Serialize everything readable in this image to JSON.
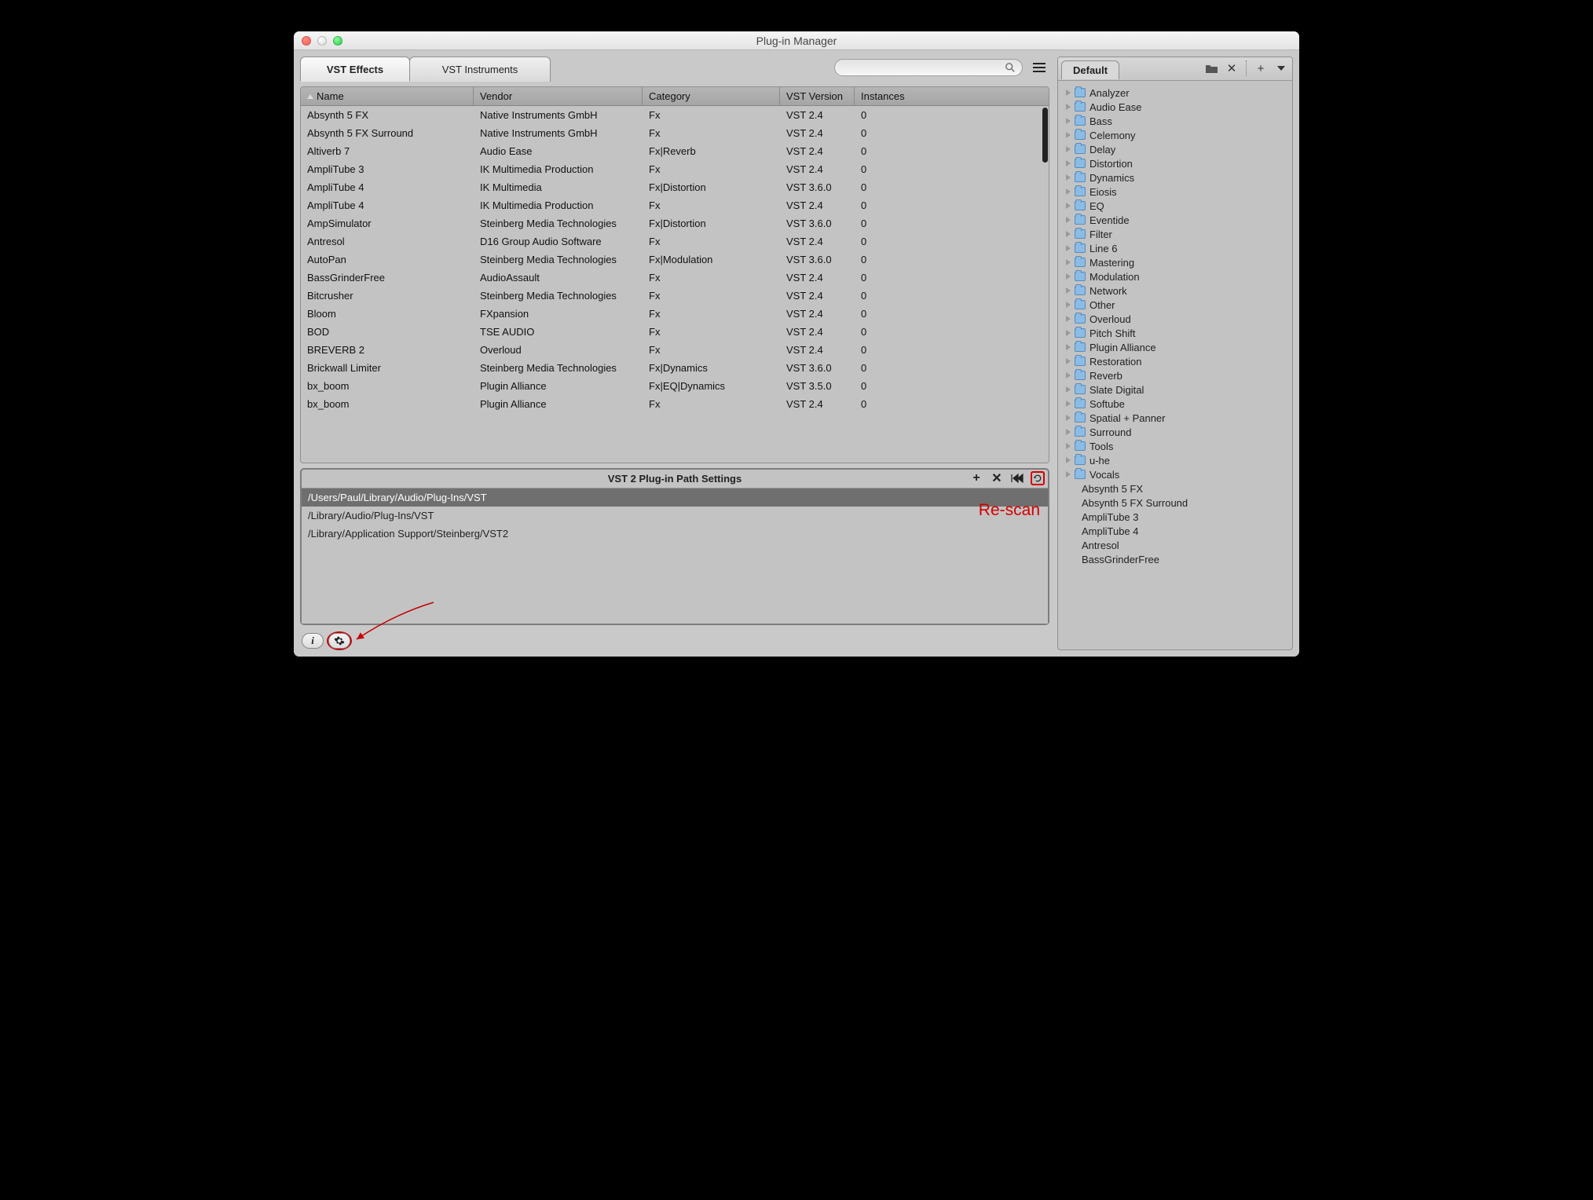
{
  "window": {
    "title": "Plug-in Manager"
  },
  "tabs": {
    "effects": "VST Effects",
    "instruments": "VST Instruments"
  },
  "search": {
    "placeholder": ""
  },
  "table": {
    "columns": {
      "name": "Name",
      "vendor": "Vendor",
      "category": "Category",
      "version": "VST Version",
      "instances": "Instances"
    },
    "rows": [
      {
        "name": "Absynth 5 FX",
        "vendor": "Native Instruments GmbH",
        "category": "Fx",
        "version": "VST 2.4",
        "instances": "0"
      },
      {
        "name": "Absynth 5 FX Surround",
        "vendor": "Native Instruments GmbH",
        "category": "Fx",
        "version": "VST 2.4",
        "instances": "0"
      },
      {
        "name": "Altiverb 7",
        "vendor": "Audio Ease",
        "category": "Fx|Reverb",
        "version": "VST 2.4",
        "instances": "0"
      },
      {
        "name": "AmpliTube 3",
        "vendor": "IK Multimedia Production",
        "category": "Fx",
        "version": "VST 2.4",
        "instances": "0"
      },
      {
        "name": "AmpliTube 4",
        "vendor": "IK Multimedia",
        "category": "Fx|Distortion",
        "version": "VST 3.6.0",
        "instances": "0"
      },
      {
        "name": "AmpliTube 4",
        "vendor": "IK Multimedia Production",
        "category": "Fx",
        "version": "VST 2.4",
        "instances": "0"
      },
      {
        "name": "AmpSimulator",
        "vendor": "Steinberg Media Technologies",
        "category": "Fx|Distortion",
        "version": "VST 3.6.0",
        "instances": "0"
      },
      {
        "name": "Antresol",
        "vendor": "D16 Group Audio Software",
        "category": "Fx",
        "version": "VST 2.4",
        "instances": "0"
      },
      {
        "name": "AutoPan",
        "vendor": "Steinberg Media Technologies",
        "category": "Fx|Modulation",
        "version": "VST 3.6.0",
        "instances": "0"
      },
      {
        "name": "BassGrinderFree",
        "vendor": "AudioAssault",
        "category": "Fx",
        "version": "VST 2.4",
        "instances": "0"
      },
      {
        "name": "Bitcrusher",
        "vendor": "Steinberg Media Technologies",
        "category": "Fx",
        "version": "VST 2.4",
        "instances": "0"
      },
      {
        "name": "Bloom",
        "vendor": "FXpansion",
        "category": "Fx",
        "version": "VST 2.4",
        "instances": "0"
      },
      {
        "name": "BOD",
        "vendor": "TSE AUDIO",
        "category": "Fx",
        "version": "VST 2.4",
        "instances": "0"
      },
      {
        "name": "BREVERB 2",
        "vendor": "Overloud",
        "category": "Fx",
        "version": "VST 2.4",
        "instances": "0"
      },
      {
        "name": "Brickwall Limiter",
        "vendor": "Steinberg Media Technologies",
        "category": "Fx|Dynamics",
        "version": "VST 3.6.0",
        "instances": "0"
      },
      {
        "name": "bx_boom",
        "vendor": "Plugin Alliance",
        "category": "Fx|EQ|Dynamics",
        "version": "VST 3.5.0",
        "instances": "0"
      },
      {
        "name": "bx_boom",
        "vendor": "Plugin Alliance",
        "category": "Fx",
        "version": "VST 2.4",
        "instances": "0"
      }
    ]
  },
  "paths": {
    "title": "VST 2 Plug-in Path Settings",
    "list": [
      "/Users/Paul/Library/Audio/Plug-Ins/VST",
      "/Library/Audio/Plug-Ins/VST",
      "/Library/Application Support/Steinberg/VST2"
    ],
    "annotation": "Re-scan"
  },
  "sidebar": {
    "tab": "Default",
    "folders": [
      "Analyzer",
      "Audio Ease",
      "Bass",
      "Celemony",
      "Delay",
      "Distortion",
      "Dynamics",
      "Eiosis",
      "EQ",
      "Eventide",
      "Filter",
      "Line 6",
      "Mastering",
      "Modulation",
      "Network",
      "Other",
      "Overloud",
      "Pitch Shift",
      "Plugin Alliance",
      "Restoration",
      "Reverb",
      "Slate Digital",
      "Softube",
      "Spatial + Panner",
      "Surround",
      "Tools",
      "u-he",
      "Vocals"
    ],
    "items": [
      "Absynth 5 FX",
      "Absynth 5 FX Surround",
      "AmpliTube 3",
      "AmpliTube 4",
      "Antresol",
      "BassGrinderFree"
    ]
  }
}
